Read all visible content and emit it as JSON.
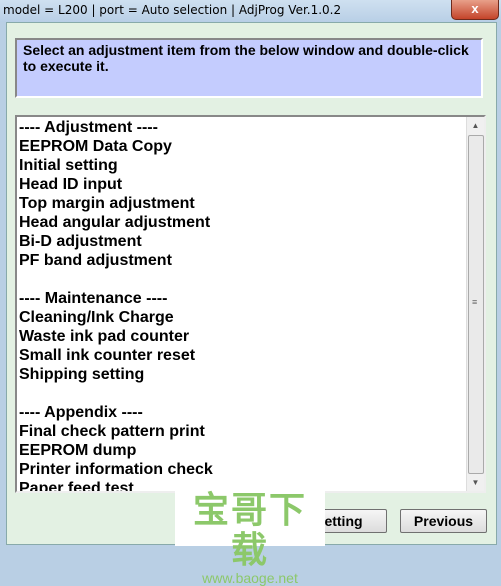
{
  "window": {
    "title": "model = L200 | port = Auto selection | AdjProg Ver.1.0.2",
    "close_label": "x"
  },
  "instruction": "Select an adjustment item from the below window and double-click to execute it.",
  "items": [
    "---- Adjustment ----",
    "EEPROM Data Copy",
    "Initial setting",
    "Head ID input",
    "Top margin adjustment",
    "Head angular adjustment",
    "Bi-D adjustment",
    "PF band adjustment",
    "",
    "---- Maintenance ----",
    "Cleaning/Ink Charge",
    "Waste ink pad counter",
    "Small ink counter reset",
    "Shipping setting",
    "",
    "---- Appendix ----",
    "Final check pattern print",
    "EEPROM dump",
    "Printer information check",
    "Paper feed test"
  ],
  "buttons": {
    "setting": "etting",
    "previous": "Previous"
  },
  "watermark": {
    "chinese": "宝哥下载",
    "url": "www.baoge.net"
  }
}
